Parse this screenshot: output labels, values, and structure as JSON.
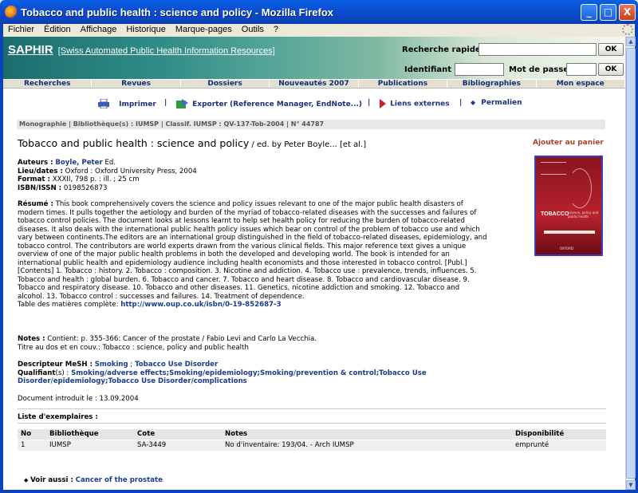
{
  "window": {
    "title": "Tobacco and public health : science and policy - Mozilla Firefox",
    "buttons": {
      "minimize": "_",
      "maximize": "□",
      "close": "X"
    }
  },
  "menu": [
    "Fichier",
    "Édition",
    "Affichage",
    "Historique",
    "Marque-pages",
    "Outils",
    "?"
  ],
  "banner": {
    "logo": "SAPHIR",
    "subtitle": "[Swiss Automated Public Health Information Resources]",
    "quick_search_label": "Recherche rapide :",
    "quick_search_value": "",
    "login_label": "Identifiant :",
    "login_value": "",
    "password_label": "Mot de passe :",
    "password_value": "",
    "ok_label": "OK"
  },
  "nav": [
    "Recherches",
    "Revues",
    "Dossiers",
    "Nouveautés 2007",
    "Publications",
    "Bibliographies",
    "Mon espace"
  ],
  "tools": {
    "print": "Imprimer",
    "export": "Exporter (Reference Manager, EndNote...)",
    "external": "Liens externes",
    "permalink": "Permalien",
    "sep": "|"
  },
  "classbar": "Monographie | Bibliothèque(s) : IUMSP | Classif. IUMSP : QV-137-Tob-2004 | N° 44787",
  "record": {
    "title": "Tobacco and public health : science and policy",
    "responsibility": " / ed. by Peter Boyle... [et al.]",
    "add_to_cart": "Ajouter au panier",
    "auteurs_label": "Auteurs :",
    "auteurs_value": "Boyle, Peter",
    "auteurs_role": " Ed.",
    "lieu_label": "Lieu/dates :",
    "lieu_value": " Oxford : Oxford University Press, 2004",
    "format_label": "Format :",
    "format_value": " XXXII, 798 p. : ill. ; 25 cm",
    "isbn_label": "ISBN/ISSN :",
    "isbn_value": " 0198526873",
    "resume_label": "Résumé :",
    "resume_text": " This book comprehensively covers the science and policy issues relevant to one of the major public health disasters of modern times. It pulls together the aetiology and burden of the myriad of tobacco-related diseases with the successes and failures of tobacco control policies. The document looks at lessons learnt to help set health policy for reducing the burden of tobacco-related diseases. It also deals with the international public health policy issues which bear on control of the problem of tobacco use and which vary between continents.The editors are an international group distinguished in the field of tobacco-related diseases, epidemiology, and tobacco control. The contributors are world experts drawn from the various clinical fields. This major reference text gives a unique overview of one of the major public health problems in both the developed and developing world. The book is intended for an international public health and epidemiology audience including health economists and those interested in tobacco control. [Publ.] [Contents] 1. Tobacco : history. 2. Tobacco : composition. 3. Nicotine and addiction. 4. Tobacco use : prevalence, trends, influences. 5. Tobacco and health : global burden. 6. Tobacco and cancer. 7. Tobacco and heart disease. 8. Tobacco and cardiovascular disease. 9. Tobacco and respiratory disease. 10. Tobacco and other diseases. 11. Genetics, nicotine addiction and smoking. 12. Tobacco and alcohol. 13. Tobacco control : successes and failures. 14. Treatment of dependence.",
    "toc_label": "Table des matières complète: ",
    "toc_link": "http://www.oup.co.uk/isbn/0-19-852687-3",
    "notes_label": "Notes :",
    "notes_line1": " Contient: p. 355-366: Cancer of the prostate / Fabio Levi and Carlo La Vecchia.",
    "notes_line2": "Titre au dos et en couv.: Tobacco : science, policy and public health",
    "mesh_label": "Descripteur MeSH :",
    "mesh_links": [
      "Smoking",
      "Tobacco Use Disorder"
    ],
    "qualifiant_label": "Qualifiant",
    "qualifiant_suffix": "(s) : ",
    "qualifiant_links": [
      "Smoking/adverse effects",
      "Smoking/epidemiology",
      "Smoking/prevention & control",
      "Tobacco Use Disorder/epidemiology",
      "Tobacco Use Disorder/complications"
    ],
    "doc_date": "Document introduit le : 13.09.2004"
  },
  "cover": {
    "title": "TOBACCO",
    "subtitle": "science, policy and public health",
    "publisher": "OXFORD"
  },
  "exemplaires": {
    "title": "Liste d'exemplaires :",
    "headers": [
      "No",
      "Bibliothèque",
      "Cote",
      "Notes",
      "Disponibilité"
    ],
    "rows": [
      [
        "1",
        "IUMSP",
        "SA-3449",
        "No d'inventaire: 193/04. - Arch IUMSP",
        "emprunté"
      ]
    ]
  },
  "see_also": {
    "label": "Voir aussi :",
    "link": "Cancer of the prostate"
  }
}
